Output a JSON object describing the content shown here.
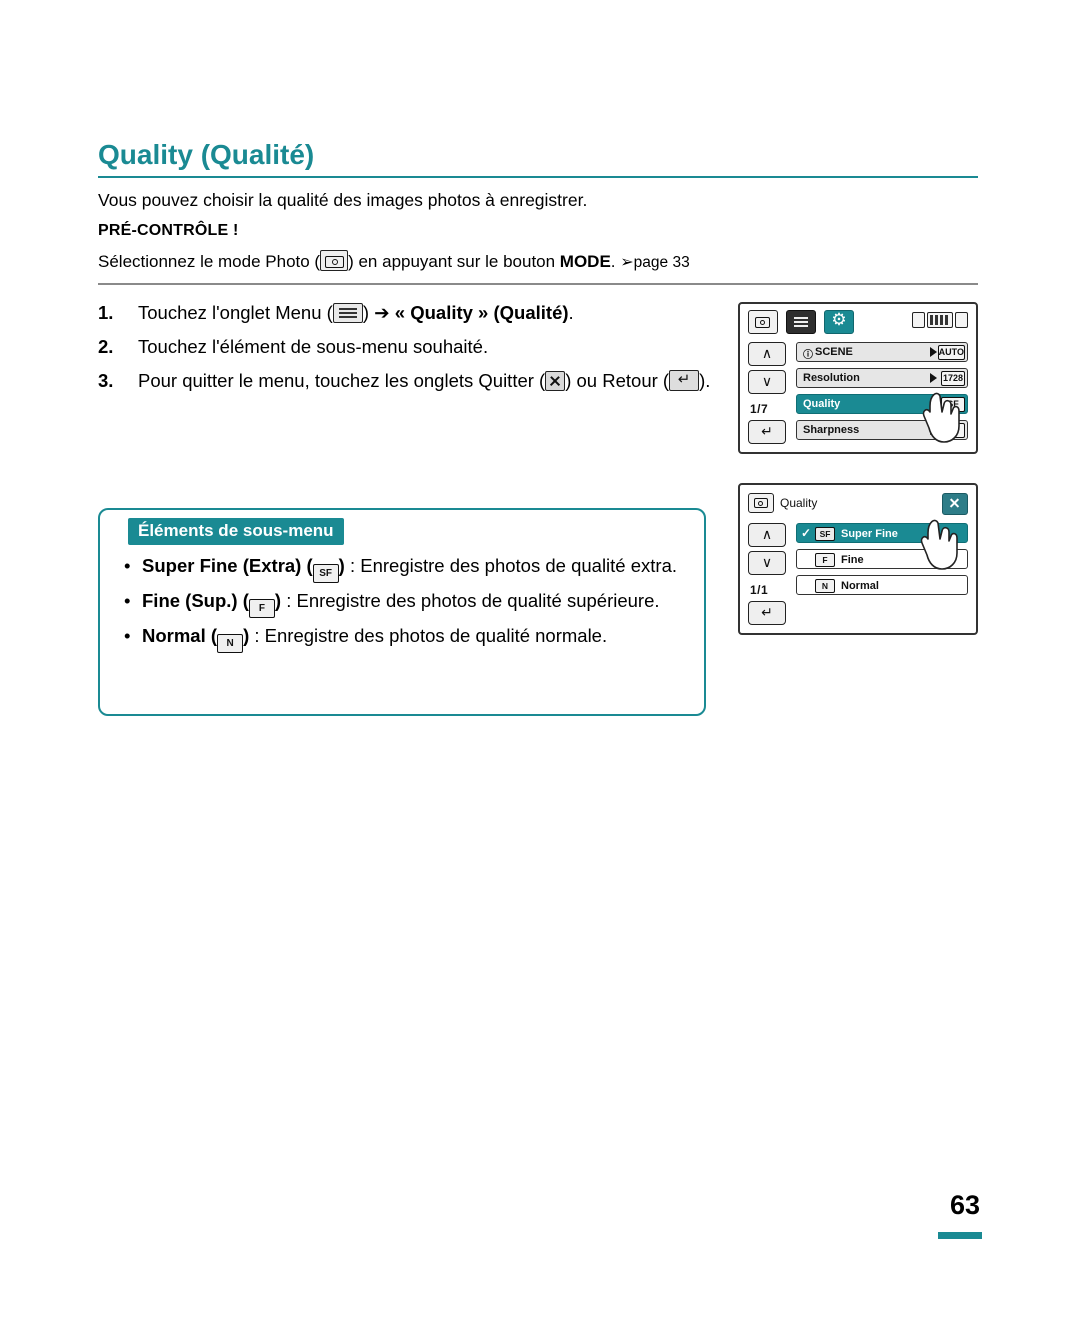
{
  "title": "Quality (Qualité)",
  "intro": "Vous pouvez choisir la qualité des images photos à enregistrer.",
  "precheck": {
    "label": "PRÉ-CONTRÔLE !",
    "text_part1": "Sélectionnez le mode Photo (",
    "text_part2": ") en appuyant sur le bouton ",
    "mode_word": "MODE",
    "text_part3": ". ",
    "page_ref": "page 33"
  },
  "steps": [
    {
      "num": "1.",
      "part1": "Touchez l'onglet Menu (",
      "part2": ") ",
      "arrow": "➔",
      "part3": " « Quality » (Qualité)",
      "part4": "."
    },
    {
      "num": "2.",
      "part1": "Touchez l'élément de sous-menu souhaité."
    },
    {
      "num": "3.",
      "part1": "Pour quitter le menu, touchez les onglets Quitter (",
      "part2": ") ou Retour (",
      "part3": ")."
    }
  ],
  "submenu": {
    "heading": "Éléments de sous-menu",
    "items": [
      {
        "bullet": "•",
        "name": "Super Fine (Extra)",
        "icon": "SF",
        "desc": " : Enregistre des photos de qualité extra."
      },
      {
        "bullet": "•",
        "name": "Fine (Sup.)",
        "icon": "F",
        "desc": " : Enregistre des photos de qualité supérieure."
      },
      {
        "bullet": "•",
        "name": "Normal",
        "icon": "N",
        "desc": " : Enregistre des photos de qualité normale."
      }
    ]
  },
  "device1": {
    "page_indicator": "1/7",
    "rows": [
      {
        "label": "SCENE",
        "value": "AUTO",
        "prefix": "i"
      },
      {
        "label": "Resolution",
        "value": "1728"
      },
      {
        "label": "Quality",
        "value": "SF"
      },
      {
        "label": "Sharpness",
        "value": "■"
      }
    ],
    "up_arrow": "∧",
    "down_arrow": "∨",
    "back_arrow": "↵"
  },
  "device2": {
    "title": "Quality",
    "page_indicator": "1/1",
    "options": [
      {
        "check": "✓",
        "icon": "SF",
        "label": "Super Fine",
        "selected": true
      },
      {
        "check": "",
        "icon": "F",
        "label": "Fine",
        "selected": false
      },
      {
        "check": "",
        "icon": "N",
        "label": "Normal",
        "selected": false
      }
    ],
    "up_arrow": "∧",
    "down_arrow": "∨",
    "back_arrow": "↵"
  },
  "page_number": "63",
  "colors": {
    "accent": "#1a8a93",
    "text": "#000000"
  }
}
